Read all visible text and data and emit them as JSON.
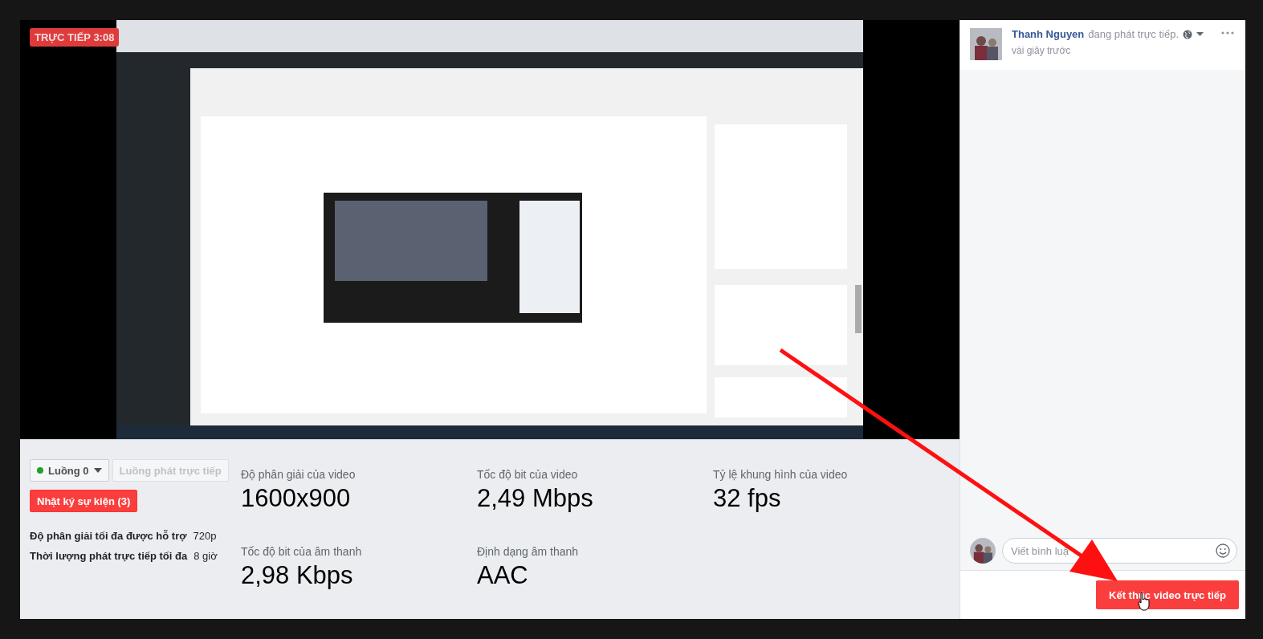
{
  "video": {
    "kind": "picture",
    "badge": "TRỰC TIẾP 3:08"
  },
  "stream": {
    "selector": "Luồng 0",
    "stream_button": {
      "label": "Luồng phát trực tiếp",
      "disabled": true
    },
    "event_log_button": "Nhật ký sự kiện (3)",
    "limits": [
      {
        "label": "Độ phân giải tối đa được hỗ trợ",
        "value": "720p"
      },
      {
        "label": "Thời lượng phát trực tiếp tối đa",
        "value": "8 giờ"
      }
    ],
    "stats": [
      {
        "label": "Độ phân giải của video",
        "value": "1600x900"
      },
      {
        "label": "Tốc độ bit của video",
        "value": "2,49 Mbps"
      },
      {
        "label": "Tỷ lệ khung hình của video",
        "value": "32 fps"
      },
      {
        "label": "Tốc độ bit của âm thanh",
        "value": "2,98 Kbps"
      },
      {
        "label": "Định dạng âm thanh",
        "value": "AAC"
      }
    ]
  },
  "post": {
    "author": "Thanh Nguyen",
    "action": "đang phát trực tiếp.",
    "time": "vài giây trước"
  },
  "comment": {
    "placeholder": "Viết bình luậ"
  },
  "end_button": "Kết thúc video trực tiếp"
}
